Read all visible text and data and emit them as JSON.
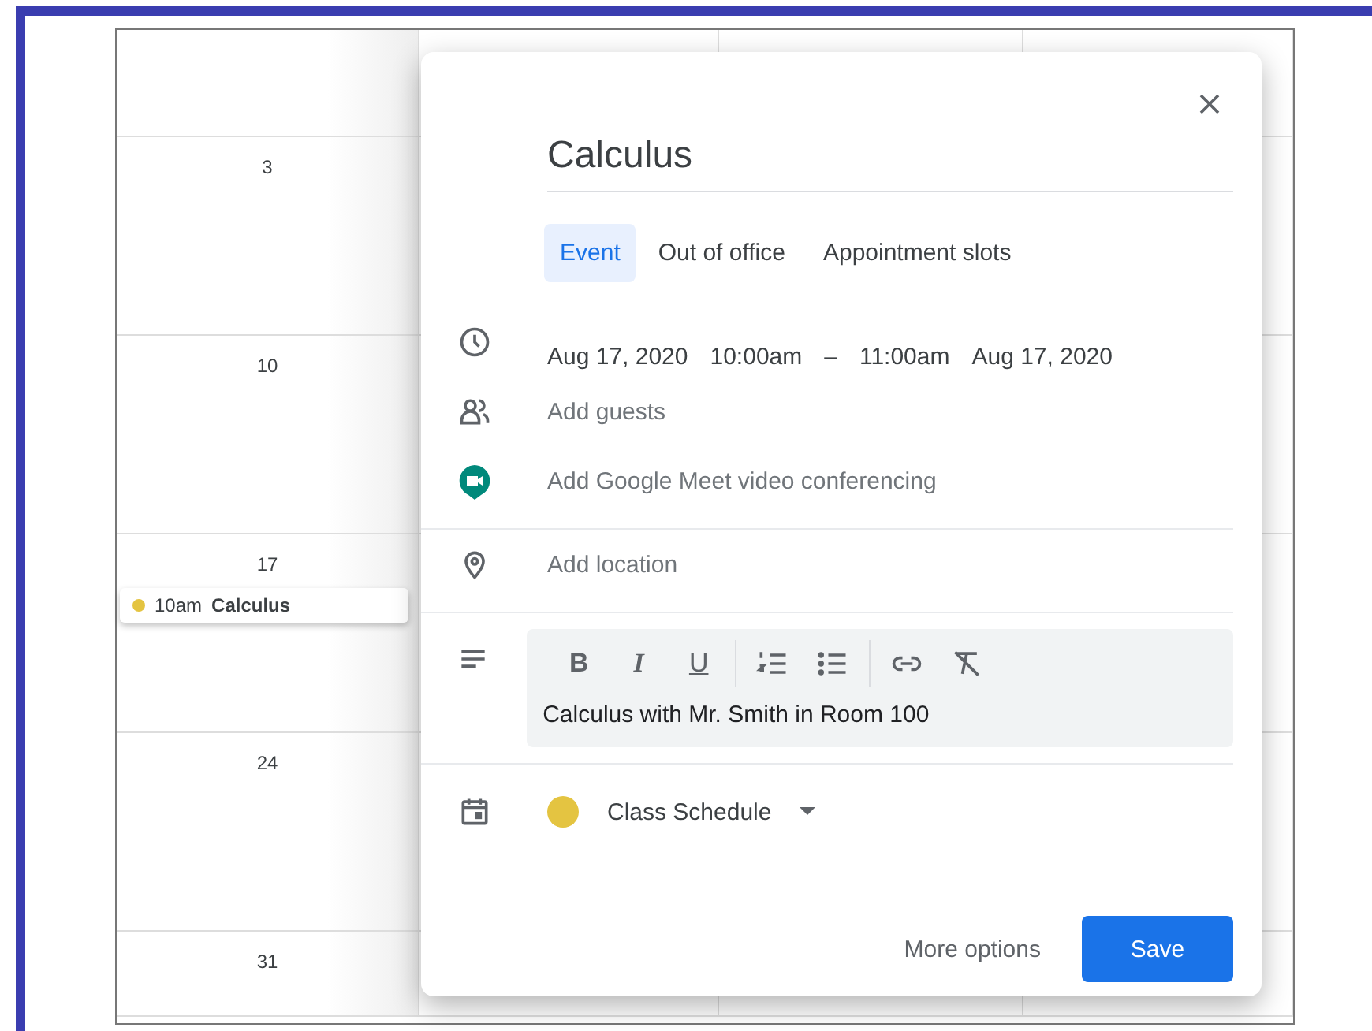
{
  "calendar": {
    "weeks": [
      {
        "date": "3"
      },
      {
        "date": "10"
      },
      {
        "date": "17",
        "events": [
          {
            "time": "10am",
            "title": "Calculus",
            "color": "#e4c441"
          }
        ]
      },
      {
        "date": "24"
      },
      {
        "date": "31"
      }
    ]
  },
  "dialog": {
    "title": "Calculus",
    "tabs": [
      {
        "label": "Event",
        "selected": true
      },
      {
        "label": "Out of office",
        "selected": false
      },
      {
        "label": "Appointment slots",
        "selected": false
      }
    ],
    "when": {
      "start_date": "Aug 17, 2020",
      "start_time": "10:00am",
      "separator": "–",
      "end_time": "11:00am",
      "end_date": "Aug 17, 2020"
    },
    "guests": {
      "placeholder": "Add guests"
    },
    "conferencing": "Add Google Meet video conferencing",
    "location": {
      "placeholder": "Add location"
    },
    "toolbar_groups": [
      [
        {
          "kind": "bold",
          "label": "B"
        },
        {
          "kind": "italic",
          "label": "I"
        },
        {
          "kind": "underline",
          "label": "U"
        }
      ],
      [
        {
          "kind": "numbered-list"
        },
        {
          "kind": "bullet-list"
        }
      ],
      [
        {
          "kind": "link"
        },
        {
          "kind": "clear-format"
        }
      ]
    ],
    "description": "Calculus with Mr. Smith in Room 100",
    "calendar": {
      "name": "Class Schedule",
      "color": "#e4c441"
    },
    "buttons": [
      "More options",
      "Save"
    ]
  }
}
